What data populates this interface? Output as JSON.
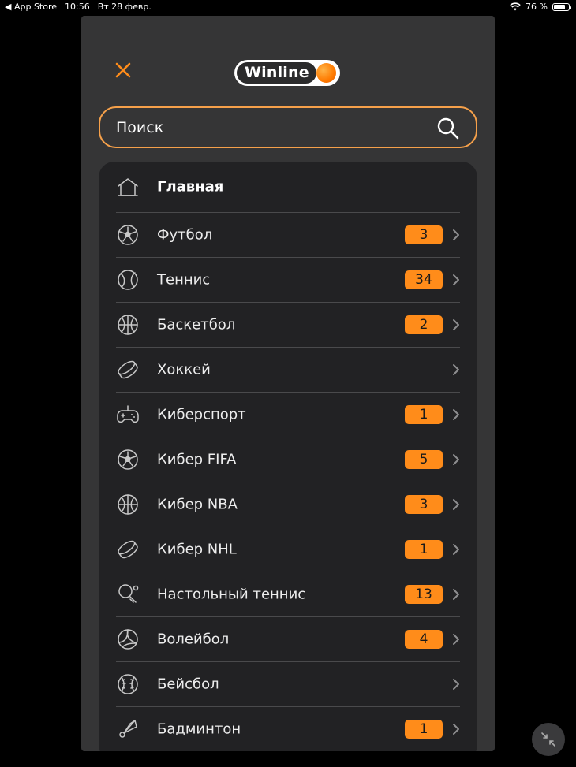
{
  "status_bar": {
    "app_back": "◀ App Store",
    "time": "10:56",
    "date": "Вт 28 февр.",
    "battery": "76 %",
    "battery_level": 0.76
  },
  "header": {
    "logo_text": "Winline",
    "close_icon": "close-icon",
    "accent_color": "#ff8c1a"
  },
  "search": {
    "placeholder": "Поиск",
    "value": ""
  },
  "menu": {
    "items": [
      {
        "label": "Главная",
        "icon": "home-icon",
        "count": ""
      },
      {
        "label": "Футбол",
        "icon": "soccer-ball-icon",
        "count": "3"
      },
      {
        "label": "Теннис",
        "icon": "tennis-ball-icon",
        "count": "34"
      },
      {
        "label": "Баскетбол",
        "icon": "basketball-icon",
        "count": "2"
      },
      {
        "label": "Хоккей",
        "icon": "hockey-puck-icon",
        "count": ""
      },
      {
        "label": "Киберспорт",
        "icon": "gamepad-icon",
        "count": "1"
      },
      {
        "label": "Кибер FIFA",
        "icon": "soccer-ball-icon",
        "count": "5"
      },
      {
        "label": "Кибер NBA",
        "icon": "basketball-icon",
        "count": "3"
      },
      {
        "label": "Кибер NHL",
        "icon": "hockey-puck-icon",
        "count": "1"
      },
      {
        "label": "Настольный теннис",
        "icon": "table-tennis-icon",
        "count": "13"
      },
      {
        "label": "Волейбол",
        "icon": "volleyball-icon",
        "count": "4"
      },
      {
        "label": "Бейсбол",
        "icon": "baseball-icon",
        "count": ""
      },
      {
        "label": "Бадминтон",
        "icon": "shuttlecock-icon",
        "count": "1"
      }
    ]
  }
}
